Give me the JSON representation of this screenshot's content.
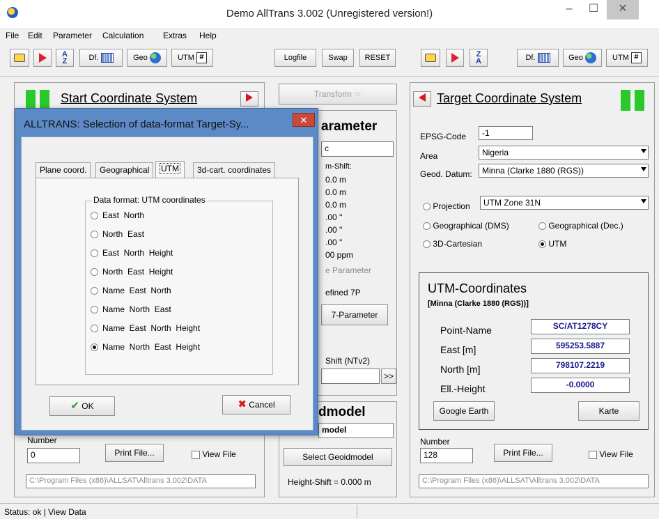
{
  "window": {
    "title": "Demo AllTrans 3.002 (Unregistered version!)",
    "min_glyph": "–",
    "max_glyph": "☐",
    "close_glyph": "✕"
  },
  "menu": [
    "File",
    "Edit",
    "Parameter",
    "Calculation",
    "Extras",
    "Help"
  ],
  "toolbar": {
    "left": {
      "df": "Df.",
      "geo": "Geo",
      "utm": "UTM"
    },
    "middle": {
      "logfile": "Logfile",
      "swap": "Swap",
      "reset": "RESET"
    },
    "right": {
      "df": "Df.",
      "geo": "Geo",
      "utm": "UTM"
    }
  },
  "start_panel": {
    "title": "Start Coordinate System",
    "number_label": "Number",
    "number_value": "0",
    "print_file": "Print File...",
    "view_file": "View File",
    "path": "C:\\Program Files (x86)\\ALLSAT\\Alltrans 3.002\\DATA"
  },
  "middle_panel": {
    "transform": "Transform",
    "heading": "arameter",
    "input_top": "c",
    "shift_label": "m-Shift:",
    "values": [
      "0.0 m",
      "0.0 m",
      "0.0 m",
      ".00 ''",
      ".00 ''",
      ".00 ''",
      "00 ppm"
    ],
    "more_params": "e Parameter",
    "defined": "efined 7P",
    "seven_param_btn": "7-Parameter",
    "shift_ntv2": "Shift (NTv2)",
    "more_btn": ">>",
    "geoid_heading": "dmodel",
    "geoid_value": "model",
    "select_geoid": "Select Geoidmodel",
    "height_shift": "Height-Shift  =  0.000 m"
  },
  "target_panel": {
    "title": "Target Coordinate System",
    "epsg_label": "EPSG-Code",
    "epsg_value": "-1",
    "area_label": "Area",
    "area_value": "Nigeria",
    "datum_label": "Geod. Datum:",
    "datum_value": "Minna (Clarke 1880 (RGS))",
    "projection_label": "Projection",
    "projection_value": "UTM Zone 31N",
    "geo_dms": "Geographical (DMS)",
    "geo_dec": "Geographical (Dec.)",
    "cart": "3D-Cartesian",
    "utm": "UTM",
    "utm_box": {
      "title": "UTM-Coordinates",
      "datum": "[Minna (Clarke 1880 (RGS))]",
      "point_label": "Point-Name",
      "point_value": "SC/AT1278CY",
      "east_label": "East [m]",
      "east_value": "595253.5887",
      "north_label": "North [m]",
      "north_value": "798107.2219",
      "height_label": "Ell.-Height",
      "height_value": "-0.0000",
      "google_earth": "Google Earth",
      "karte": "Karte"
    },
    "number_label": "Number",
    "number_value": "128",
    "print_file": "Print File...",
    "view_file": "View File",
    "path": "C:\\Program Files (x86)\\ALLSAT\\Alltrans 3.002\\DATA"
  },
  "dialog": {
    "title": "ALLTRANS: Selection of data-format Target-Sy...",
    "close": "✕",
    "tabs": [
      "Plane coord.",
      "Geographical",
      "UTM",
      "3d-cart. coordinates"
    ],
    "group_title": "Data format: UTM coordinates",
    "options": [
      "East  North",
      "North  East",
      "East  North  Height",
      "North  East  Height",
      "Name  East  North",
      "Name  North  East",
      "Name  East  North  Height",
      "Name  North  East  Height"
    ],
    "selected_index": 7,
    "ok": "OK",
    "cancel": "Cancel"
  },
  "status": "Status: ok | View Data",
  "colors": {
    "accent_blue": "#1a1a8c",
    "green": "#2ac82a",
    "red_arrow": "#d41a1a",
    "dialog_frame": "#5c8ac6"
  }
}
